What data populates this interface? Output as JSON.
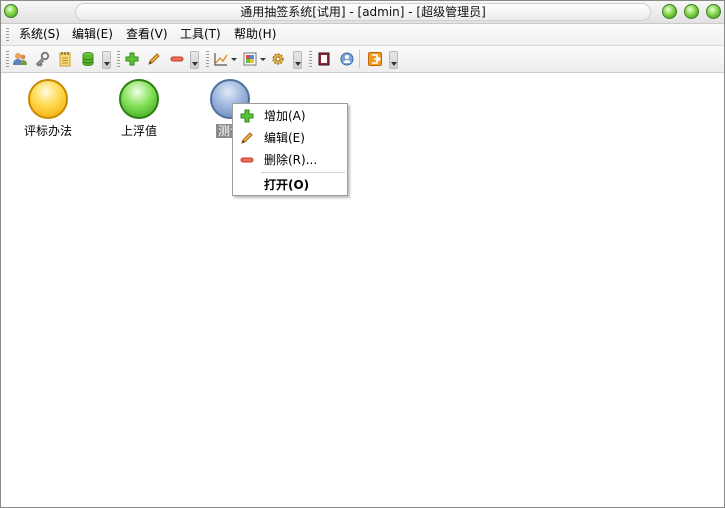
{
  "window": {
    "title": "通用抽签系统[试用]  - [admin] - [超级管理员]"
  },
  "menubar": {
    "items": [
      "系统(S)",
      "编辑(E)",
      "查看(V)",
      "工具(T)",
      "帮助(H)"
    ]
  },
  "toolbar": {
    "icons": [
      "users-icon",
      "key-icon",
      "notepad-icon",
      "database-icon",
      "add-icon",
      "edit-icon",
      "delete-icon",
      "chart-icon",
      "palette-icon",
      "gear-icon",
      "book-icon",
      "user-search-icon",
      "exit-icon"
    ]
  },
  "desktop": {
    "items": [
      {
        "label": "评标办法",
        "color": "yellow"
      },
      {
        "label": "上浮值",
        "color": "green"
      },
      {
        "label": "测试",
        "color": "blue",
        "selected": true
      }
    ]
  },
  "context_menu": {
    "items": [
      {
        "label": "增加(A)",
        "icon": "add-icon"
      },
      {
        "label": "编辑(E)",
        "icon": "edit-icon"
      },
      {
        "label": "删除(R)...",
        "icon": "delete-icon"
      },
      {
        "label": "打开(O)",
        "icon": "",
        "bold": true
      }
    ]
  },
  "colors": {
    "accent_green": "#4fbf2a",
    "delete_red": "#e8604c",
    "add_green": "#44b52a"
  }
}
